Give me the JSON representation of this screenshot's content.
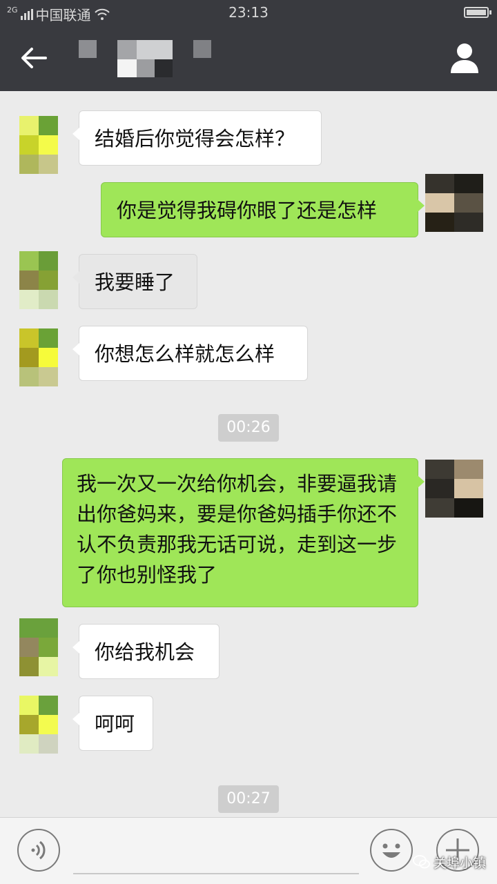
{
  "status_bar": {
    "network": "2G",
    "carrier": "中国联通",
    "time": "23:13"
  },
  "header": {
    "back_icon": "arrow-left-icon",
    "contact_icon": "person-icon",
    "title_obscured": true
  },
  "messages": [
    {
      "side": "in",
      "text": "结婚后你觉得会怎样？"
    },
    {
      "side": "out",
      "text": "你是觉得我碍你眼了还是怎样"
    },
    {
      "side": "in",
      "text": "我要睡了",
      "style": "grey"
    },
    {
      "side": "in",
      "text": "你想怎么样就怎么样"
    },
    {
      "type": "time",
      "text": "00:26"
    },
    {
      "side": "out",
      "text": "我一次又一次给你机会，非要逼我请出你爸妈来，要是你爸妈插手你还不认不负责那我无话可说，走到这一步了你也别怪我了"
    },
    {
      "side": "in",
      "text": "你给我机会"
    },
    {
      "side": "in",
      "text": "呵呵"
    },
    {
      "type": "time",
      "text": "00:27"
    }
  ],
  "input_bar": {
    "voice_icon": "voice-icon",
    "emoji_icon": "smiley-icon",
    "plus_icon": "plus-icon"
  },
  "watermark": {
    "text": "关埠小镇",
    "icon": "wechat-logo-icon"
  },
  "colors": {
    "header_bg": "#393a3f",
    "chat_bg": "#ebebeb",
    "outgoing_bubble": "#9fe658",
    "incoming_bubble": "#ffffff"
  }
}
